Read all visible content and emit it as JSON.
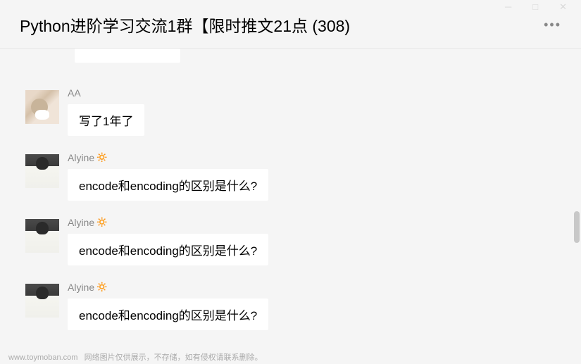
{
  "header": {
    "title": "Python进阶学习交流1群【限时推文21点 (308)"
  },
  "messages": [
    {
      "sender": "AA",
      "avatar_type": "cat",
      "has_emoji": false,
      "text": "写了1年了"
    },
    {
      "sender": "Alyine",
      "avatar_type": "person",
      "has_emoji": true,
      "text": "encode和encoding的区别是什么?"
    },
    {
      "sender": "Alyine",
      "avatar_type": "person",
      "has_emoji": true,
      "text": "encode和encoding的区别是什么?"
    },
    {
      "sender": "Alyine",
      "avatar_type": "person",
      "has_emoji": true,
      "text": "encode和encoding的区别是什么?"
    }
  ],
  "emoji": "🔅",
  "footer": {
    "domain": "www.toymoban.com",
    "notice": "网络图片仅供展示，不存储，如有侵权请联系删除。"
  }
}
